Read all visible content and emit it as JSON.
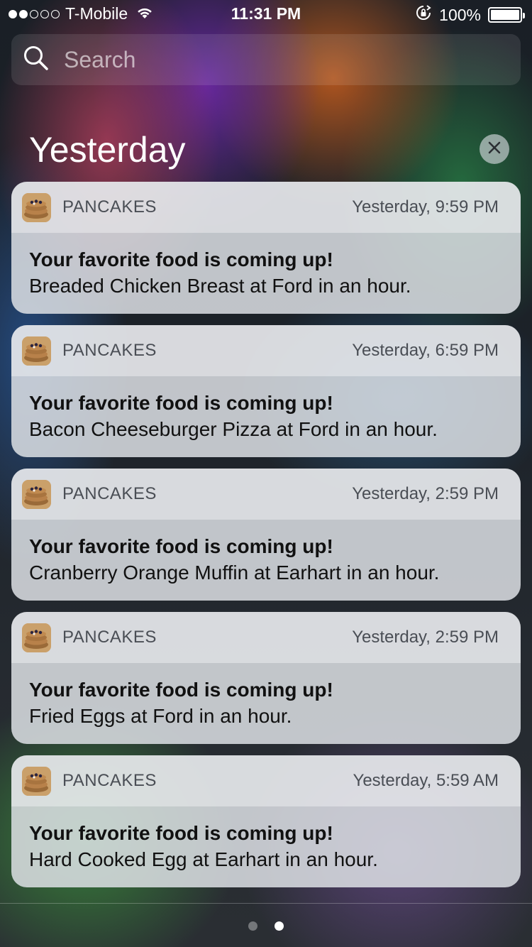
{
  "status_bar": {
    "carrier": "T-Mobile",
    "signal_strength": 2,
    "signal_max": 5,
    "time": "11:31 PM",
    "battery_percent": "100%",
    "battery_level": 1.0
  },
  "search": {
    "placeholder": "Search"
  },
  "section": {
    "title": "Yesterday"
  },
  "notifications": [
    {
      "app": "PANCAKES",
      "time": "Yesterday, 9:59 PM",
      "title": "Your favorite food is coming up!",
      "body": "Breaded Chicken Breast at Ford in an hour."
    },
    {
      "app": "PANCAKES",
      "time": "Yesterday, 6:59 PM",
      "title": "Your favorite food is coming up!",
      "body": "Bacon Cheeseburger Pizza at Ford in an hour."
    },
    {
      "app": "PANCAKES",
      "time": "Yesterday, 2:59 PM",
      "title": "Your favorite food is coming up!",
      "body": "Cranberry Orange Muffin at Earhart in an hour."
    },
    {
      "app": "PANCAKES",
      "time": "Yesterday, 2:59 PM",
      "title": "Your favorite food is coming up!",
      "body": "Fried Eggs at Ford in an hour."
    },
    {
      "app": "PANCAKES",
      "time": "Yesterday, 5:59 AM",
      "title": "Your favorite food is coming up!",
      "body": "Hard Cooked Egg at Earhart in an hour."
    }
  ],
  "page_indicator": {
    "pages": 2,
    "active_page": 2
  },
  "icons": {
    "wifi": "wifi-icon",
    "rotation_lock": "rotation-lock-icon",
    "battery": "battery-icon",
    "search": "search-icon",
    "clear": "close-icon",
    "app": "pancakes-app-icon"
  }
}
